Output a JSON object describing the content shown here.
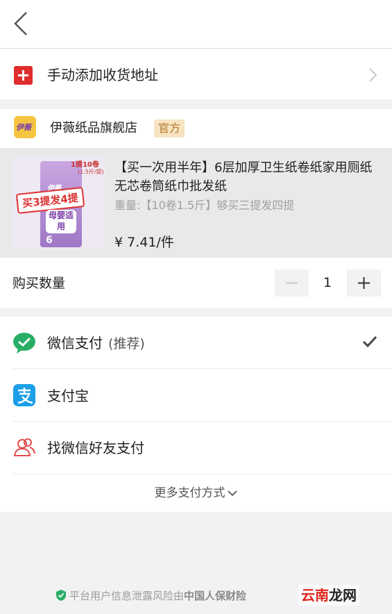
{
  "header": {
    "back_icon": "chevron-left-icon"
  },
  "address": {
    "label": "手动添加收货地址",
    "icon": "plus-icon",
    "accent": "#e02d2d"
  },
  "shop": {
    "logo_text": "伊薇",
    "name": "伊薇纸品旗舰店",
    "badge": "官方"
  },
  "product": {
    "image": {
      "badge_line1": "1提10卷",
      "badge_line2": "(1.5斤/提)",
      "brand": "伊薇",
      "banner": "买3提发4提",
      "label": "母婴适用",
      "count": "6"
    },
    "title": "【买一次用半年】6层加厚卫生纸卷纸家用厕纸无芯卷筒纸巾批发纸",
    "spec": "重量:【10卷1.5斤】够买三提发四提",
    "price": "¥ 7.41/件"
  },
  "quantity": {
    "label": "购买数量",
    "value": "1"
  },
  "payment": {
    "options": [
      {
        "label": "微信支付",
        "note": "(推荐)",
        "icon": "wechat-pay-icon",
        "selected": true
      },
      {
        "label": "支付宝",
        "note": "",
        "icon": "alipay-icon",
        "selected": false
      },
      {
        "label": "找微信好友支付",
        "note": "",
        "icon": "friends-icon",
        "selected": false
      }
    ],
    "more_label": "更多支付方式"
  },
  "footer": {
    "notice": "平台用户信息泄露风险由",
    "insurer": "中国人保财险",
    "watermark_a": "云南",
    "watermark_b": "龙网"
  },
  "colors": {
    "wechat_green": "#2aae67",
    "alipay_blue": "#1a9fe8",
    "red": "#e02d2d"
  }
}
